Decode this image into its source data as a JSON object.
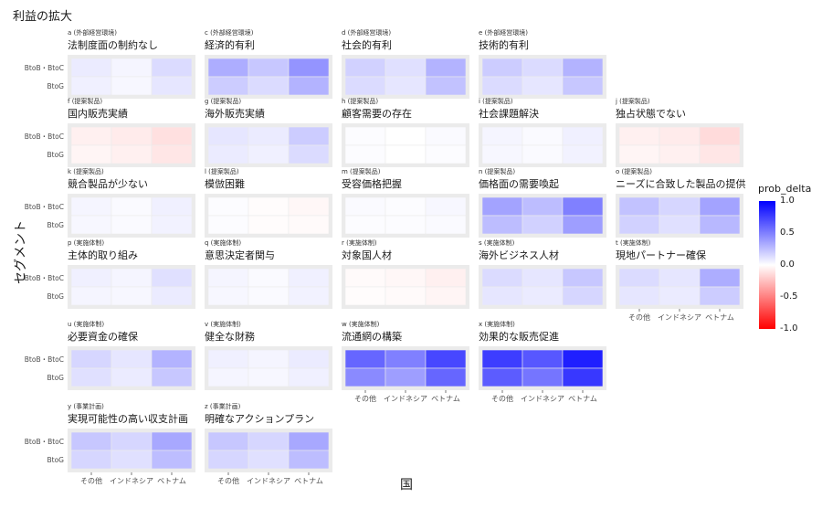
{
  "title": "利益の拡大",
  "chart_data": {
    "type": "heatmap",
    "xlabel": "国",
    "ylabel": "セグメント",
    "categories": [
      "その他",
      "インドネシア",
      "ベトナム"
    ],
    "segments": [
      "BtoB・BtoC",
      "BtoG"
    ],
    "legend": {
      "title": "prob_delta",
      "ticks": [
        "1.0",
        "0.5",
        "0.0",
        "-0.5",
        "-1.0"
      ],
      "range": [
        -1,
        1
      ],
      "position": "right"
    },
    "colors": {
      "high": "#0000ff",
      "mid": "#ffffff",
      "low": "#ff0000"
    },
    "panels": [
      {
        "tag": "a (外部経営環境)",
        "name": "法制度面の制約なし",
        "values": [
          [
            0.08,
            0.04,
            0.14
          ],
          [
            0.06,
            0.03,
            0.1
          ]
        ]
      },
      {
        "tag": "c (外部経営環境)",
        "name": "経済的有利",
        "values": [
          [
            0.32,
            0.22,
            0.42
          ],
          [
            0.2,
            0.14,
            0.3
          ]
        ]
      },
      {
        "tag": "d (外部経営環境)",
        "name": "社会的有利",
        "values": [
          [
            0.18,
            0.12,
            0.3
          ],
          [
            0.14,
            0.1,
            0.24
          ]
        ]
      },
      {
        "tag": "e (外部経営環境)",
        "name": "技術的有利",
        "values": [
          [
            0.2,
            0.14,
            0.3
          ],
          [
            0.14,
            0.1,
            0.22
          ]
        ]
      },
      {
        "tag": "f (提案製品)",
        "name": "国内販売実績",
        "values": [
          [
            -0.06,
            -0.08,
            -0.12
          ],
          [
            -0.04,
            -0.06,
            -0.1
          ]
        ]
      },
      {
        "tag": "g (提案製品)",
        "name": "海外販売実績",
        "values": [
          [
            0.1,
            0.08,
            0.2
          ],
          [
            0.08,
            0.06,
            0.14
          ]
        ]
      },
      {
        "tag": "h (提案製品)",
        "name": "顧客需要の存在",
        "values": [
          [
            0.01,
            0.0,
            0.02
          ],
          [
            0.01,
            0.0,
            0.01
          ]
        ]
      },
      {
        "tag": "i (提案製品)",
        "name": "社会課題解決",
        "values": [
          [
            0.04,
            0.02,
            0.06
          ],
          [
            0.03,
            0.02,
            0.05
          ]
        ]
      },
      {
        "tag": "j (提案製品)",
        "name": "独占状態でない",
        "values": [
          [
            -0.06,
            -0.08,
            -0.14
          ],
          [
            -0.04,
            -0.06,
            -0.1
          ]
        ]
      },
      {
        "tag": "k (提案製品)",
        "name": "競合製品が少ない",
        "values": [
          [
            0.04,
            0.02,
            0.06
          ],
          [
            0.03,
            0.02,
            0.05
          ]
        ]
      },
      {
        "tag": "l (提案製品)",
        "name": "模倣困難",
        "values": [
          [
            0.01,
            -0.01,
            -0.03
          ],
          [
            0.01,
            -0.01,
            -0.02
          ]
        ]
      },
      {
        "tag": "m (提案製品)",
        "name": "受容価格把握",
        "values": [
          [
            0.02,
            0.01,
            0.03
          ],
          [
            0.01,
            0.01,
            0.02
          ]
        ]
      },
      {
        "tag": "n (提案製品)",
        "name": "価格面の需要喚起",
        "values": [
          [
            0.36,
            0.26,
            0.5
          ],
          [
            0.26,
            0.18,
            0.38
          ]
        ]
      },
      {
        "tag": "o (提案製品)",
        "name": "ニーズに合致した製品の提供",
        "values": [
          [
            0.24,
            0.16,
            0.36
          ],
          [
            0.18,
            0.12,
            0.28
          ]
        ]
      },
      {
        "tag": "p (実施体制)",
        "name": "主体的取り組み",
        "values": [
          [
            0.06,
            0.04,
            0.12
          ],
          [
            0.04,
            0.03,
            0.08
          ]
        ]
      },
      {
        "tag": "q (実施体制)",
        "name": "意思決定者関与",
        "values": [
          [
            0.04,
            0.02,
            0.06
          ],
          [
            0.03,
            0.02,
            0.05
          ]
        ]
      },
      {
        "tag": "r (実施体制)",
        "name": "対象国人材",
        "values": [
          [
            -0.02,
            -0.03,
            -0.06
          ],
          [
            -0.01,
            -0.02,
            -0.04
          ]
        ]
      },
      {
        "tag": "s (実施体制)",
        "name": "海外ビジネス人材",
        "values": [
          [
            0.14,
            0.1,
            0.22
          ],
          [
            0.1,
            0.08,
            0.16
          ]
        ]
      },
      {
        "tag": "t (実施体制)",
        "name": "現地パートナー確保",
        "values": [
          [
            0.14,
            0.1,
            0.32
          ],
          [
            0.1,
            0.08,
            0.2
          ]
        ]
      },
      {
        "tag": "u (実施体制)",
        "name": "必要資金の確保",
        "values": [
          [
            0.16,
            0.1,
            0.3
          ],
          [
            0.12,
            0.08,
            0.22
          ]
        ]
      },
      {
        "tag": "v (実施体制)",
        "name": "健全な財務",
        "values": [
          [
            0.06,
            0.04,
            0.08
          ],
          [
            0.04,
            0.03,
            0.06
          ]
        ]
      },
      {
        "tag": "w (実施体制)",
        "name": "流通網の構築",
        "values": [
          [
            0.6,
            0.5,
            0.72
          ],
          [
            0.46,
            0.38,
            0.6
          ]
        ]
      },
      {
        "tag": "x (実施体制)",
        "name": "効果的な販売促進",
        "values": [
          [
            0.76,
            0.66,
            0.88
          ],
          [
            0.64,
            0.54,
            0.78
          ]
        ]
      },
      {
        "tag": "y (事業計画)",
        "name": "実現可能性の高い収支計画",
        "values": [
          [
            0.22,
            0.16,
            0.34
          ],
          [
            0.16,
            0.12,
            0.26
          ]
        ]
      },
      {
        "tag": "z (事業計画)",
        "name": "明確なアクションプラン",
        "values": [
          [
            0.22,
            0.16,
            0.34
          ],
          [
            0.16,
            0.12,
            0.26
          ]
        ]
      }
    ]
  }
}
